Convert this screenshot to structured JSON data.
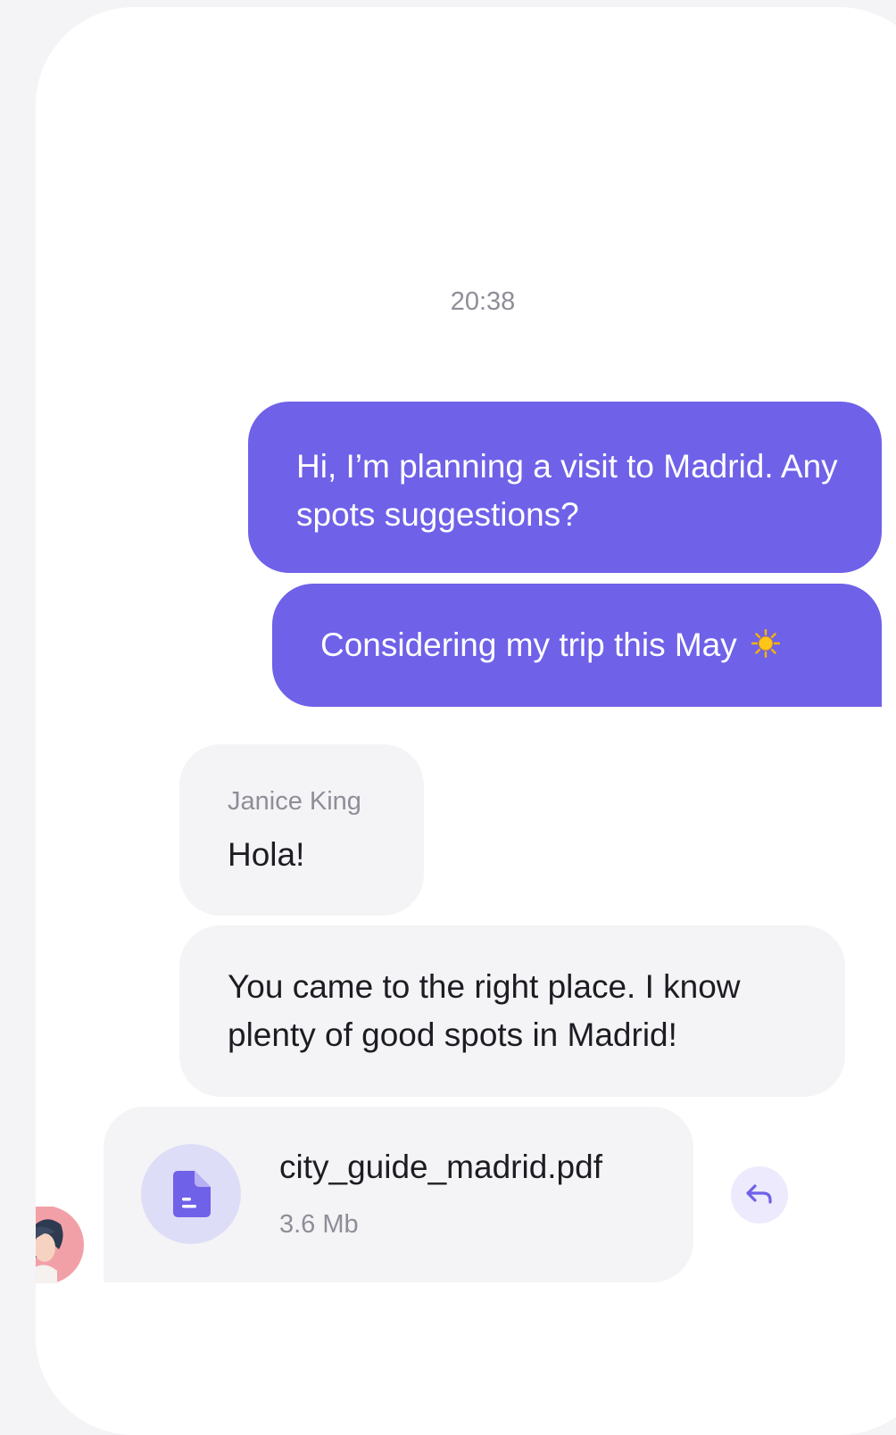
{
  "conversation": {
    "timestamp": "20:38",
    "outgoing": [
      {
        "text": "Hi, I’m planning a visit to Madrid. Any spots suggestions?"
      },
      {
        "text": "Considering my trip this May"
      }
    ],
    "incoming": {
      "sender": "Janice King",
      "messages": [
        {
          "text": "Hola!"
        },
        {
          "text": "You came to the right place. I know plenty of good spots in Madrid!"
        }
      ],
      "attachment": {
        "file_name": "city_guide_madrid.pdf",
        "file_size": "3.6 Mb",
        "icon": "document-icon"
      }
    }
  },
  "colors": {
    "outgoing_bubble": "#6f61e8",
    "incoming_bubble": "#f4f4f6",
    "accent": "#6f61e8",
    "muted_text": "#8e8e98"
  },
  "icons": {
    "sun": "sun-emoji-icon",
    "reply": "reply-arrow-icon",
    "avatar": "avatar-janice-king"
  }
}
